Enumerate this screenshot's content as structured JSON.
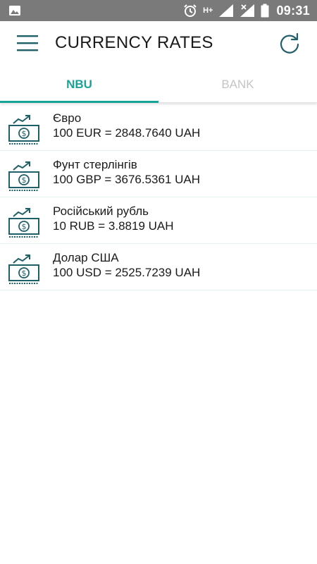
{
  "status_bar": {
    "time": "09:31",
    "network": "H+"
  },
  "app_bar": {
    "title": "CURRENCY RATES"
  },
  "tabs": [
    {
      "label": "NBU",
      "active": true
    },
    {
      "label": "BANK",
      "active": false
    }
  ],
  "rates": [
    {
      "name": "Євро",
      "rate": "100 EUR = 2848.7640 UAH"
    },
    {
      "name": "Фунт стерлінгів",
      "rate": "100 GBP = 3676.5361 UAH"
    },
    {
      "name": "Російський рубль",
      "rate": "10 RUB = 3.8819 UAH"
    },
    {
      "name": "Долар США",
      "rate": "100 USD = 2525.7239 UAH"
    }
  ],
  "colors": {
    "accent": "#17a398",
    "icon": "#1f5f68",
    "status_bar": "#7a7a7a",
    "tab_inactive": "#c4c4c4"
  }
}
